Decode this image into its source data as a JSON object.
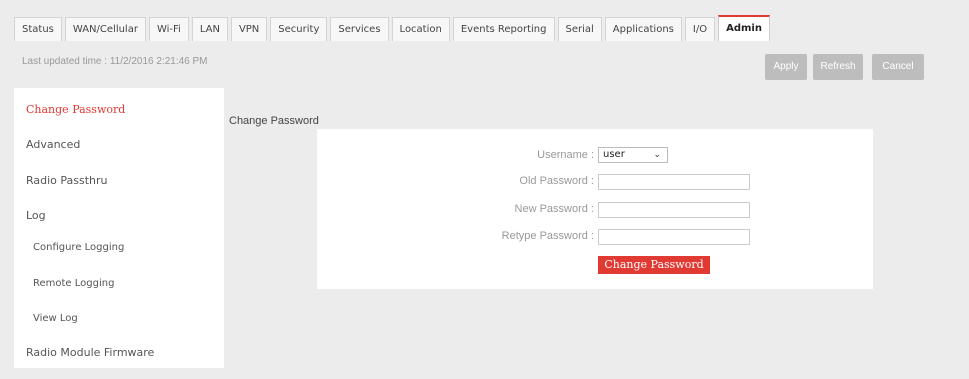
{
  "tabs": [
    "Status",
    "WAN/Cellular",
    "Wi-Fi",
    "LAN",
    "VPN",
    "Security",
    "Services",
    "Location",
    "Events Reporting",
    "Serial",
    "Applications",
    "I/O",
    "Admin"
  ],
  "active_tab": "Admin",
  "status": {
    "last_updated": "Last updated time : 11/2/2016 2:21:46 PM"
  },
  "actions": {
    "apply": "Apply",
    "refresh": "Refresh",
    "cancel": "Cancel"
  },
  "sidebar": {
    "items": [
      {
        "label": "Change Password",
        "active": true
      },
      {
        "label": "Advanced"
      },
      {
        "label": "Radio Passthru"
      },
      {
        "label": "Log"
      },
      {
        "label": "Configure Logging",
        "sub": true
      },
      {
        "label": "Remote Logging",
        "sub": true
      },
      {
        "label": "View Log",
        "sub": true
      },
      {
        "label": "Radio Module Firmware"
      }
    ]
  },
  "main": {
    "section_title": "Change Password",
    "form": {
      "username_label": "Username :",
      "username_value": "user",
      "old_password_label": "Old Password :",
      "new_password_label": "New Password :",
      "retype_password_label": "Retype Password :",
      "submit_label": "Change Password"
    }
  },
  "colors": {
    "accent": "#e03a33",
    "button_gray": "#bdbdbd",
    "background": "#ececec"
  }
}
